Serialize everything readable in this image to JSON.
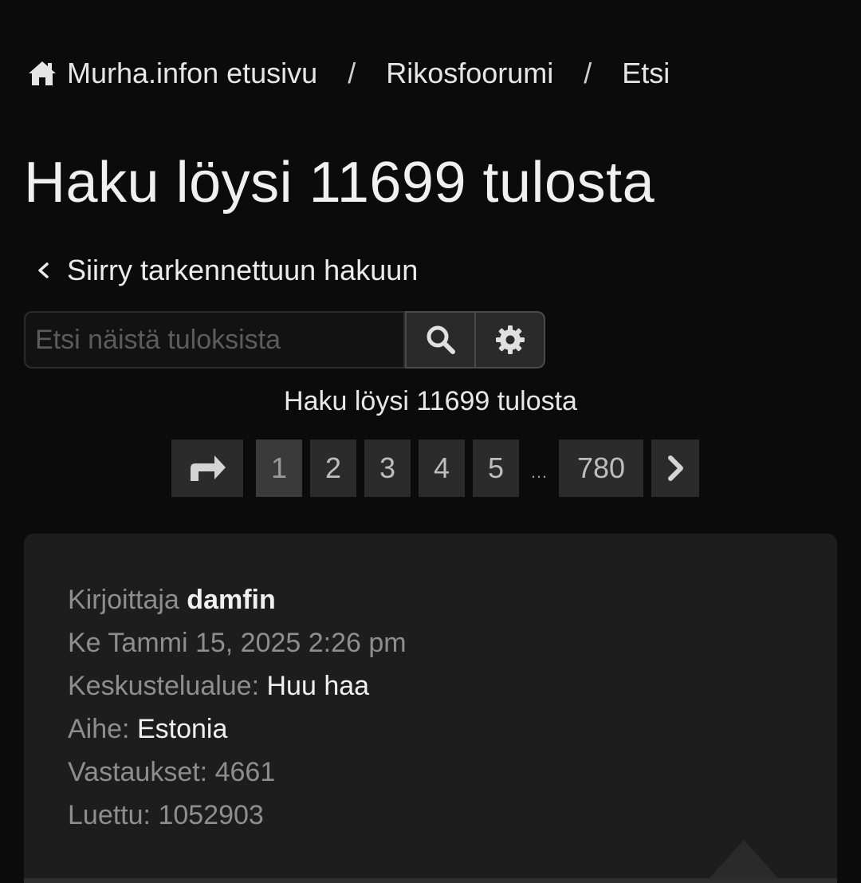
{
  "breadcrumb": {
    "home_icon": "home-icon",
    "home_label": "Murha.infon etusivu",
    "separator": "/",
    "forum_label": "Rikosfoorumi",
    "current_label": "Etsi"
  },
  "title": "Haku löysi 11699 tulosta",
  "advanced_search": {
    "icon": "chevron-left-icon",
    "label": "Siirry tarkennettuun hakuun"
  },
  "search": {
    "placeholder": "Etsi näistä tuloksista",
    "value": "",
    "search_icon": "search-icon",
    "settings_icon": "gear-icon"
  },
  "result_count": "Haku löysi 11699 tulosta",
  "pagination": {
    "jump_icon": "share-forward-icon",
    "pages": [
      "1",
      "2",
      "3",
      "4",
      "5"
    ],
    "active_page": "1",
    "ellipsis": "…",
    "last_page": "780",
    "next_icon": "chevron-right-icon"
  },
  "result": {
    "author_label": "Kirjoittaja",
    "author": "damfin",
    "date": "Ke Tammi 15, 2025 2:26 pm",
    "forum_label": "Keskustelualue:",
    "forum": "Huu haa",
    "topic_label": "Aihe:",
    "topic": "Estonia",
    "replies_label": "Vastaukset:",
    "replies": "4661",
    "views_label": "Luettu:",
    "views": "1052903"
  },
  "colors": {
    "background": "#0b0b0b",
    "card": "#1d1d1d",
    "pagination_bg": "#2b2b2b",
    "muted_text": "#8e8e8e"
  }
}
